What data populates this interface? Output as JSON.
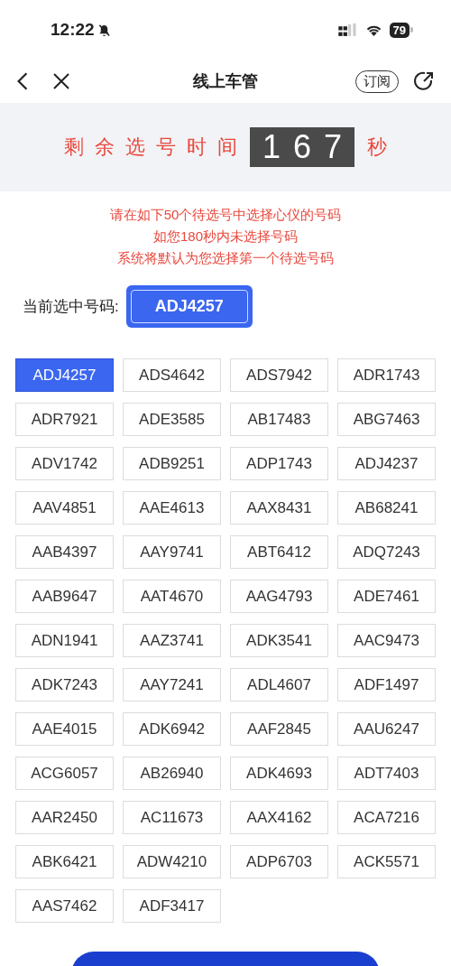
{
  "status_bar": {
    "time": "12:22",
    "muted": true,
    "battery": "79"
  },
  "nav": {
    "title": "线上车管",
    "subscribe": "订阅"
  },
  "timer": {
    "label": "剩余选号时间",
    "digits": "167",
    "unit": "秒"
  },
  "notice": [
    "请在如下50个待选号中选择心仪的号码",
    "如您180秒内未选择号码",
    "系统将默认为您选择第一个待选号码"
  ],
  "current": {
    "label": "当前选中号码:",
    "value": "ADJ4257"
  },
  "plates": [
    {
      "text": "ADJ4257",
      "selected": true
    },
    {
      "text": "ADS4642",
      "selected": false
    },
    {
      "text": "ADS7942",
      "selected": false
    },
    {
      "text": "ADR1743",
      "selected": false
    },
    {
      "text": "ADR7921",
      "selected": false
    },
    {
      "text": "ADE3585",
      "selected": false
    },
    {
      "text": "AB17483",
      "selected": false
    },
    {
      "text": "ABG7463",
      "selected": false
    },
    {
      "text": "ADV1742",
      "selected": false
    },
    {
      "text": "ADB9251",
      "selected": false
    },
    {
      "text": "ADP1743",
      "selected": false
    },
    {
      "text": "ADJ4237",
      "selected": false
    },
    {
      "text": "AAV4851",
      "selected": false
    },
    {
      "text": "AAE4613",
      "selected": false
    },
    {
      "text": "AAX8431",
      "selected": false
    },
    {
      "text": "AB68241",
      "selected": false
    },
    {
      "text": "AAB4397",
      "selected": false
    },
    {
      "text": "AAY9741",
      "selected": false
    },
    {
      "text": "ABT6412",
      "selected": false
    },
    {
      "text": "ADQ7243",
      "selected": false
    },
    {
      "text": "AAB9647",
      "selected": false
    },
    {
      "text": "AAT4670",
      "selected": false
    },
    {
      "text": "AAG4793",
      "selected": false
    },
    {
      "text": "ADE7461",
      "selected": false
    },
    {
      "text": "ADN1941",
      "selected": false
    },
    {
      "text": "AAZ3741",
      "selected": false
    },
    {
      "text": "ADK3541",
      "selected": false
    },
    {
      "text": "AAC9473",
      "selected": false
    },
    {
      "text": "ADK7243",
      "selected": false
    },
    {
      "text": "AAY7241",
      "selected": false
    },
    {
      "text": "ADL4607",
      "selected": false
    },
    {
      "text": "ADF1497",
      "selected": false
    },
    {
      "text": "AAE4015",
      "selected": false
    },
    {
      "text": "ADK6942",
      "selected": false
    },
    {
      "text": "AAF2845",
      "selected": false
    },
    {
      "text": "AAU6247",
      "selected": false
    },
    {
      "text": "ACG6057",
      "selected": false
    },
    {
      "text": "AB26940",
      "selected": false
    },
    {
      "text": "ADK4693",
      "selected": false
    },
    {
      "text": "ADT7403",
      "selected": false
    },
    {
      "text": "AAR2450",
      "selected": false
    },
    {
      "text": "AC11673",
      "selected": false
    },
    {
      "text": "AAX4162",
      "selected": false
    },
    {
      "text": "ACA7216",
      "selected": false
    },
    {
      "text": "ABK6421",
      "selected": false
    },
    {
      "text": "ADW4210",
      "selected": false
    },
    {
      "text": "ADP6703",
      "selected": false
    },
    {
      "text": "ACK5571",
      "selected": false
    },
    {
      "text": "AAS7462",
      "selected": false
    },
    {
      "text": "ADF3417",
      "selected": false
    }
  ]
}
